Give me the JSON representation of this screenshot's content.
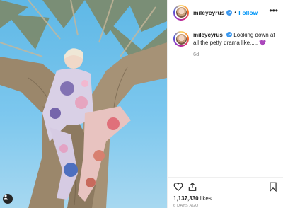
{
  "post": {
    "username": "mileycyrus",
    "follow_label": "Follow",
    "separator": "•",
    "more_label": "•••",
    "caption_text": "Looking down at all the petty drama like..... ",
    "caption_emoji": "💜",
    "time_ago": "6d",
    "likes_count": "1,137,330",
    "likes_label": "likes",
    "date": "6 DAYS AGO"
  },
  "icons": {
    "verified": "verified-badge-icon",
    "like": "heart-icon",
    "share": "share-icon",
    "save": "bookmark-icon",
    "photo_user": "user-tag-icon"
  },
  "colors": {
    "link": "#0095f6",
    "verified": "#3897f0",
    "muted": "#8e8e8e",
    "text": "#262626"
  }
}
